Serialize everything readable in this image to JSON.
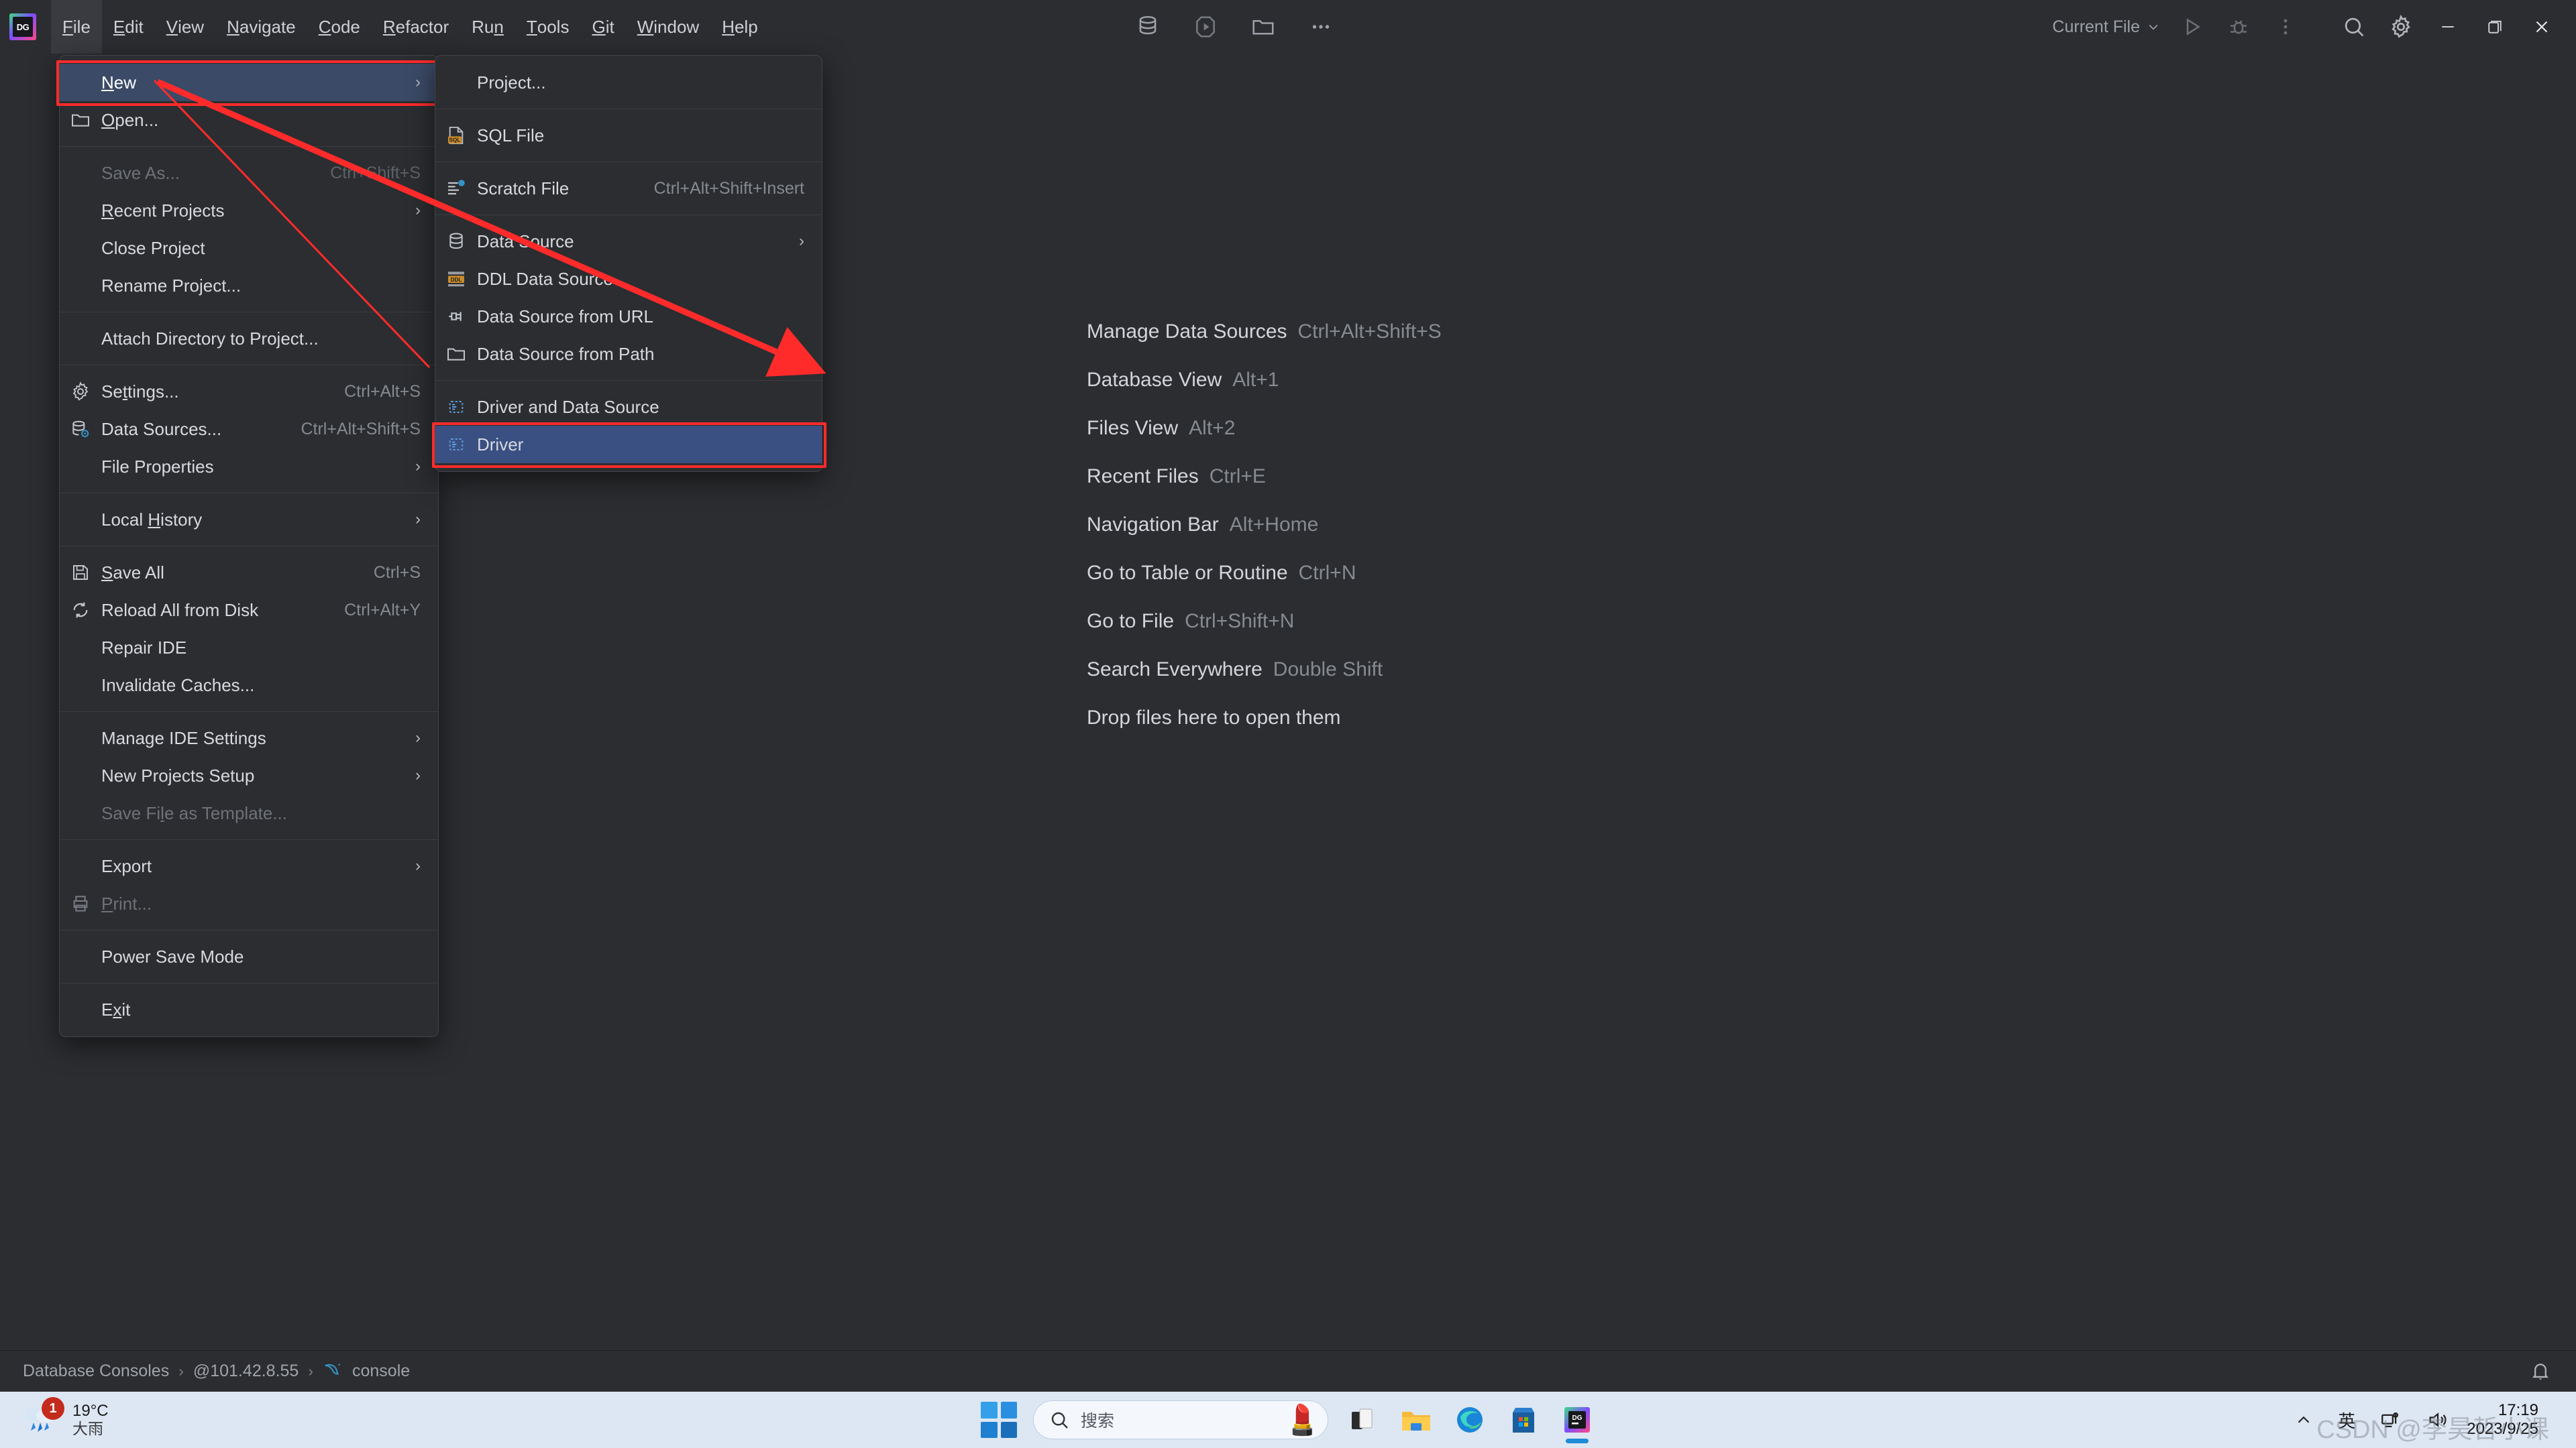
{
  "app": {
    "name": "DataGrip",
    "logo_text": "DG"
  },
  "menubar": {
    "items": [
      {
        "label": "File",
        "mnemonic": "F",
        "active": true
      },
      {
        "label": "Edit",
        "mnemonic": "E",
        "active": false
      },
      {
        "label": "View",
        "mnemonic": "V",
        "active": false
      },
      {
        "label": "Navigate",
        "mnemonic": "N",
        "active": false
      },
      {
        "label": "Code",
        "mnemonic": "C",
        "active": false
      },
      {
        "label": "Refactor",
        "mnemonic": "R",
        "active": false
      },
      {
        "label": "Run",
        "mnemonic": "n",
        "active": false
      },
      {
        "label": "Tools",
        "mnemonic": "T",
        "active": false
      },
      {
        "label": "Git",
        "mnemonic": "G",
        "active": false
      },
      {
        "label": "Window",
        "mnemonic": "W",
        "active": false
      },
      {
        "label": "Help",
        "mnemonic": "H",
        "active": false
      }
    ],
    "center_icons": [
      "database-icon",
      "run-icon",
      "folder-icon",
      "more-icon"
    ],
    "run_config": "Current File",
    "right_icons": [
      "search-icon",
      "settings-gear-icon"
    ],
    "window_controls": [
      "minimize-icon",
      "restore-icon",
      "close-icon"
    ]
  },
  "file_menu": {
    "items": [
      {
        "label": "New",
        "mnemonic": "N",
        "accel": "",
        "icon": "",
        "submenu": true,
        "disabled": false,
        "selected": true,
        "highlighted": true
      },
      {
        "label": "Open...",
        "mnemonic": "O",
        "accel": "",
        "icon": "folder-icon",
        "submenu": false,
        "disabled": false,
        "selected": false,
        "highlighted": false
      },
      {
        "sep": true
      },
      {
        "label": "Save As...",
        "mnemonic": "",
        "accel": "Ctrl+Shift+S",
        "icon": "",
        "submenu": false,
        "disabled": true,
        "selected": false,
        "highlighted": false
      },
      {
        "label": "Recent Projects",
        "mnemonic": "R",
        "accel": "",
        "icon": "",
        "submenu": true,
        "disabled": false,
        "selected": false,
        "highlighted": false
      },
      {
        "label": "Close Project",
        "mnemonic": "",
        "accel": "",
        "icon": "",
        "submenu": false,
        "disabled": false,
        "selected": false,
        "highlighted": false
      },
      {
        "label": "Rename Project...",
        "mnemonic": "",
        "accel": "",
        "icon": "",
        "submenu": false,
        "disabled": false,
        "selected": false,
        "highlighted": false
      },
      {
        "sep": true
      },
      {
        "label": "Attach Directory to Project...",
        "mnemonic": "",
        "accel": "",
        "icon": "",
        "submenu": false,
        "disabled": false,
        "selected": false,
        "highlighted": false
      },
      {
        "sep": true
      },
      {
        "label": "Settings...",
        "mnemonic": "t",
        "accel": "Ctrl+Alt+S",
        "icon": "gear-icon",
        "submenu": false,
        "disabled": false,
        "selected": false,
        "highlighted": false
      },
      {
        "label": "Data Sources...",
        "mnemonic": "",
        "accel": "Ctrl+Alt+Shift+S",
        "icon": "datasource-icon",
        "submenu": false,
        "disabled": false,
        "selected": false,
        "highlighted": false
      },
      {
        "label": "File Properties",
        "mnemonic": "",
        "accel": "",
        "icon": "",
        "submenu": true,
        "disabled": false,
        "selected": false,
        "highlighted": false
      },
      {
        "sep": true
      },
      {
        "label": "Local History",
        "mnemonic": "H",
        "accel": "",
        "icon": "",
        "submenu": true,
        "disabled": false,
        "selected": false,
        "highlighted": false
      },
      {
        "sep": true
      },
      {
        "label": "Save All",
        "mnemonic": "S",
        "accel": "Ctrl+S",
        "icon": "save-icon",
        "submenu": false,
        "disabled": false,
        "selected": false,
        "highlighted": false
      },
      {
        "label": "Reload All from Disk",
        "mnemonic": "",
        "accel": "Ctrl+Alt+Y",
        "icon": "reload-icon",
        "submenu": false,
        "disabled": false,
        "selected": false,
        "highlighted": false
      },
      {
        "label": "Repair IDE",
        "mnemonic": "",
        "accel": "",
        "icon": "",
        "submenu": false,
        "disabled": false,
        "selected": false,
        "highlighted": false
      },
      {
        "label": "Invalidate Caches...",
        "mnemonic": "",
        "accel": "",
        "icon": "",
        "submenu": false,
        "disabled": false,
        "selected": false,
        "highlighted": false
      },
      {
        "sep": true
      },
      {
        "label": "Manage IDE Settings",
        "mnemonic": "",
        "accel": "",
        "icon": "",
        "submenu": true,
        "disabled": false,
        "selected": false,
        "highlighted": false
      },
      {
        "label": "New Projects Setup",
        "mnemonic": "",
        "accel": "",
        "icon": "",
        "submenu": true,
        "disabled": false,
        "selected": false,
        "highlighted": false
      },
      {
        "label": "Save File as Template...",
        "mnemonic": "l",
        "accel": "",
        "icon": "",
        "submenu": false,
        "disabled": true,
        "selected": false,
        "highlighted": false
      },
      {
        "sep": true
      },
      {
        "label": "Export",
        "mnemonic": "",
        "accel": "",
        "icon": "",
        "submenu": true,
        "disabled": false,
        "selected": false,
        "highlighted": false
      },
      {
        "label": "Print...",
        "mnemonic": "P",
        "accel": "",
        "icon": "print-icon",
        "submenu": false,
        "disabled": true,
        "selected": false,
        "highlighted": false
      },
      {
        "sep": true
      },
      {
        "label": "Power Save Mode",
        "mnemonic": "",
        "accel": "",
        "icon": "",
        "submenu": false,
        "disabled": false,
        "selected": false,
        "highlighted": false
      },
      {
        "sep": true
      },
      {
        "label": "Exit",
        "mnemonic": "x",
        "accel": "",
        "icon": "",
        "submenu": false,
        "disabled": false,
        "selected": false,
        "highlighted": false
      }
    ]
  },
  "new_submenu": {
    "items": [
      {
        "label": "Project...",
        "accel": "",
        "icon": "",
        "submenu": false,
        "selected": false,
        "highlighted": false
      },
      {
        "sep": true
      },
      {
        "label": "SQL File",
        "accel": "",
        "icon": "sql-file-icon",
        "submenu": false,
        "selected": false,
        "highlighted": false
      },
      {
        "sep": true
      },
      {
        "label": "Scratch File",
        "accel": "Ctrl+Alt+Shift+Insert",
        "icon": "scratch-file-icon",
        "submenu": false,
        "selected": false,
        "highlighted": false
      },
      {
        "sep": true
      },
      {
        "label": "Data Source",
        "accel": "",
        "icon": "database-icon",
        "submenu": true,
        "selected": false,
        "highlighted": false
      },
      {
        "label": "DDL Data Source",
        "accel": "",
        "icon": "ddl-icon",
        "submenu": false,
        "selected": false,
        "highlighted": false
      },
      {
        "label": "Data Source from URL",
        "accel": "",
        "icon": "plug-icon",
        "submenu": false,
        "selected": false,
        "highlighted": false
      },
      {
        "label": "Data Source from Path",
        "accel": "",
        "icon": "folder-icon",
        "submenu": false,
        "selected": false,
        "highlighted": false
      },
      {
        "sep": true
      },
      {
        "label": "Driver and Data Source",
        "accel": "",
        "icon": "driver-icon",
        "submenu": false,
        "selected": false,
        "highlighted": false
      },
      {
        "label": "Driver",
        "accel": "",
        "icon": "driver-icon",
        "submenu": false,
        "selected": true,
        "highlighted": true
      }
    ]
  },
  "hints": [
    {
      "label": "Manage Data Sources",
      "key": "Ctrl+Alt+Shift+S"
    },
    {
      "label": "Database View",
      "key": "Alt+1"
    },
    {
      "label": "Files View",
      "key": "Alt+2"
    },
    {
      "label": "Recent Files",
      "key": "Ctrl+E"
    },
    {
      "label": "Navigation Bar",
      "key": "Alt+Home"
    },
    {
      "label": "Go to Table or Routine",
      "key": "Ctrl+N"
    },
    {
      "label": "Go to File",
      "key": "Ctrl+Shift+N"
    },
    {
      "label": "Search Everywhere",
      "key": "Double Shift"
    },
    {
      "label": "Drop files here to open them",
      "key": ""
    }
  ],
  "statusbar": {
    "breadcrumb": [
      "Database Consoles",
      "@101.42.8.55",
      "console"
    ],
    "right_icon": "notifications-bell-icon"
  },
  "taskbar": {
    "weather": {
      "badge": "1",
      "temp": "19°C",
      "desc": "大雨"
    },
    "search_placeholder": "搜索",
    "apps": [
      "start-icon",
      "task-view-icon",
      "file-explorer-icon",
      "edge-icon",
      "microsoft-store-icon",
      "datagrip-icon"
    ],
    "tray": {
      "chevron": "^",
      "ime": "英",
      "network": "network-icon",
      "volume": "volume-icon"
    },
    "clock": {
      "time": "17:19",
      "date": "2023/9/25"
    }
  },
  "watermark": "CSDN @李昊哲小课",
  "colors": {
    "bg": "#2B2D30",
    "menu_bg": "#2B2D30",
    "selection": "#3A5083",
    "highlight_outline": "#FF2B2B",
    "accent": "#3592C4",
    "taskbar": "#DDE7F3"
  }
}
